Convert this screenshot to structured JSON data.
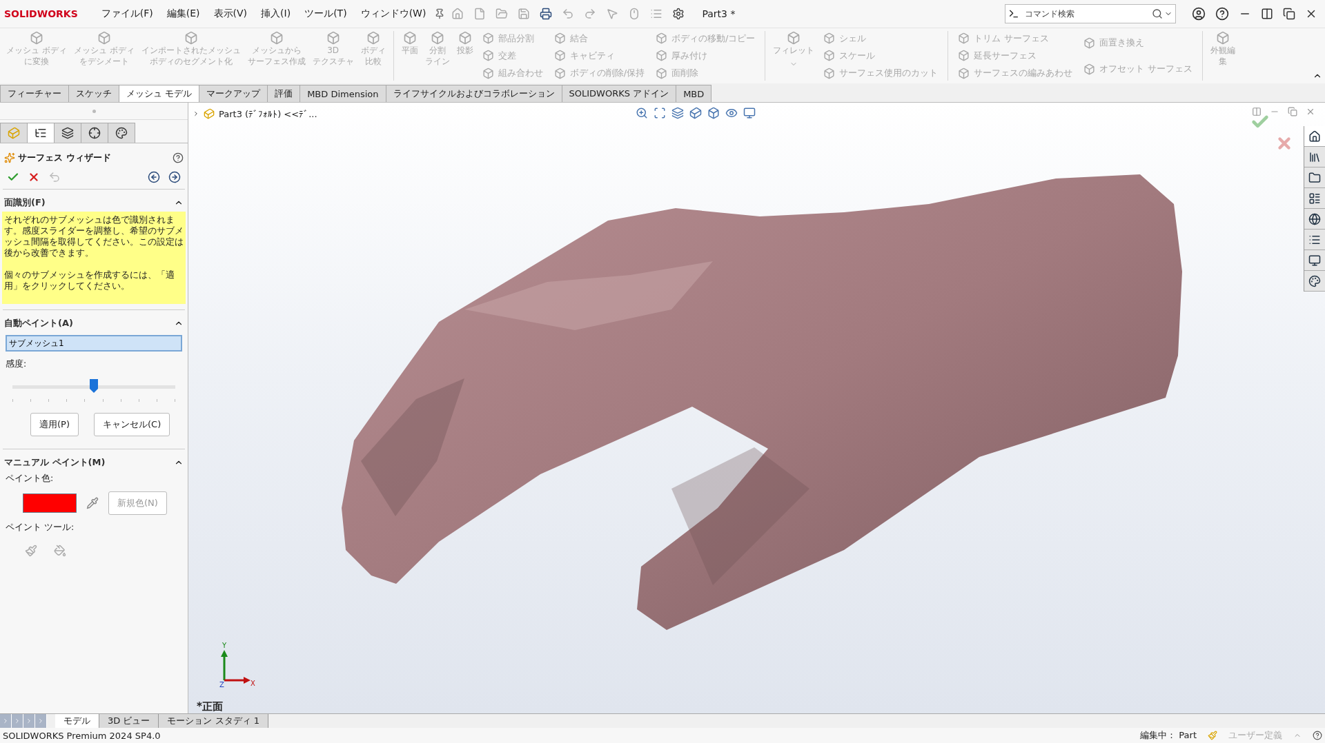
{
  "app": {
    "logo": "SOLIDWORKS",
    "document_title": "Part3 *"
  },
  "menu": [
    "ファイル(F)",
    "編集(E)",
    "表示(V)",
    "挿入(I)",
    "ツール(T)",
    "ウィンドウ(W)"
  ],
  "search": {
    "placeholder": "コマンド検索"
  },
  "ribbon": [
    {
      "kind": "large",
      "lines": [
        "メッシュ ボディ",
        "に変換"
      ],
      "disabled": true
    },
    {
      "kind": "large",
      "lines": [
        "メッシュ ボディ",
        "をデシメート"
      ],
      "disabled": true
    },
    {
      "kind": "large",
      "lines": [
        "インポートされたメッシュ",
        "ボディのセグメント化"
      ],
      "disabled": true
    },
    {
      "kind": "large",
      "lines": [
        "メッシュから",
        "サーフェス作成"
      ],
      "disabled": true
    },
    {
      "kind": "large",
      "lines": [
        "3D",
        "テクスチャ"
      ],
      "disabled": true
    },
    {
      "kind": "large",
      "lines": [
        "ボディ",
        "比較"
      ],
      "disabled": true
    },
    {
      "kind": "separator"
    },
    {
      "kind": "large",
      "lines": [
        "平面"
      ],
      "disabled": true
    },
    {
      "kind": "large",
      "lines": [
        "分割",
        "ライン"
      ],
      "disabled": true
    },
    {
      "kind": "large",
      "lines": [
        "投影"
      ],
      "disabled": true
    },
    {
      "kind": "column",
      "items": [
        {
          "label": "部品分割",
          "disabled": true
        },
        {
          "label": "交差",
          "disabled": true
        },
        {
          "label": "組み合わせ",
          "disabled": true
        }
      ]
    },
    {
      "kind": "column",
      "items": [
        {
          "label": "結合",
          "disabled": true
        },
        {
          "label": "キャビティ",
          "disabled": true
        },
        {
          "label": "ボディの削除/保持",
          "disabled": true
        }
      ]
    },
    {
      "kind": "column",
      "items": [
        {
          "label": "ボディの移動/コピー",
          "disabled": true
        },
        {
          "label": "厚み付け",
          "disabled": true
        },
        {
          "label": "面削除",
          "disabled": true
        }
      ]
    },
    {
      "kind": "separator"
    },
    {
      "kind": "split",
      "lines": [
        "フィレット"
      ],
      "disabled": true
    },
    {
      "kind": "column",
      "items": [
        {
          "label": "シェル",
          "disabled": true
        },
        {
          "label": "スケール",
          "disabled": true
        },
        {
          "label": "サーフェス使用のカット",
          "disabled": true
        }
      ]
    },
    {
      "kind": "separator"
    },
    {
      "kind": "column",
      "items": [
        {
          "label": "トリム サーフェス",
          "disabled": true
        },
        {
          "label": "延長サーフェス",
          "disabled": true
        },
        {
          "label": "サーフェスの編みあわせ",
          "disabled": true
        }
      ]
    },
    {
      "kind": "column",
      "items": [
        {
          "label": "面置き換え",
          "disabled": true
        },
        {
          "label": "オフセット サーフェス",
          "disabled": true
        }
      ]
    },
    {
      "kind": "separator"
    },
    {
      "kind": "large",
      "lines": [
        "外観編",
        "集"
      ],
      "disabled": true
    }
  ],
  "command_tabs": [
    {
      "label": "フィーチャー",
      "selected": false
    },
    {
      "label": "スケッチ",
      "selected": false
    },
    {
      "label": "メッシュ モデル",
      "selected": true
    },
    {
      "label": "マークアップ",
      "selected": false
    },
    {
      "label": "評価",
      "selected": false
    },
    {
      "label": "MBD Dimension",
      "selected": false
    },
    {
      "label": "ライフサイクルおよびコラボレーション",
      "selected": false
    },
    {
      "label": "SOLIDWORKS アドイン",
      "selected": false
    },
    {
      "label": "MBD",
      "selected": false
    }
  ],
  "panel_tabs": [
    {
      "selected": false
    },
    {
      "selected": true
    },
    {
      "selected": false
    },
    {
      "selected": false
    },
    {
      "selected": false
    }
  ],
  "property_manager": {
    "title": "サーフェス ウィザード",
    "face_identification": {
      "title": "面識別(F)",
      "message": [
        "それぞれのサブメッシュは色で識別されます。感度スライダーを調整し、希望のサブメッシュ間隔を取得してください。この設定は後から改善できます。",
        "個々のサブメッシュを作成するには、「適用」をクリックしてください。"
      ]
    },
    "auto_paint": {
      "title": "自動ペイント(A)",
      "value": "サブメッシュ1",
      "sensitivity_label": "感度:",
      "level": 0.5,
      "buttons": [
        "適用(P)",
        "キャンセル(C)"
      ]
    },
    "manual_paint": {
      "title": "マニュアル ペイント(M)",
      "color_label": "ペイント色:",
      "color": "#ff0000",
      "new_color": {
        "label": "新規色(N)",
        "disabled": true
      },
      "tool_label": "ペイント ツール:"
    }
  },
  "viewport": {
    "tree_item": "Part3 (ﾃﾞﾌｫﾙﾄ) <<ﾃﾞ...",
    "view_label": "*正面",
    "axes": [
      "Y",
      "Z",
      "X"
    ]
  },
  "task_pane_tabs": [
    {
      "selected": true
    },
    {
      "selected": false
    },
    {
      "selected": false
    },
    {
      "selected": false
    },
    {
      "selected": false
    },
    {
      "selected": false
    },
    {
      "selected": false
    },
    {
      "selected": false
    }
  ],
  "bottom_tabs": [
    {
      "label": "モデル",
      "selected": true
    },
    {
      "label": "3D ビュー",
      "selected": false
    },
    {
      "label": "モーション スタディ 1",
      "selected": false
    }
  ],
  "status_bar": {
    "product": "SOLIDWORKS Premium 2024 SP4.0",
    "editing": "編集中： Part",
    "units": "ユーザー定義"
  }
}
